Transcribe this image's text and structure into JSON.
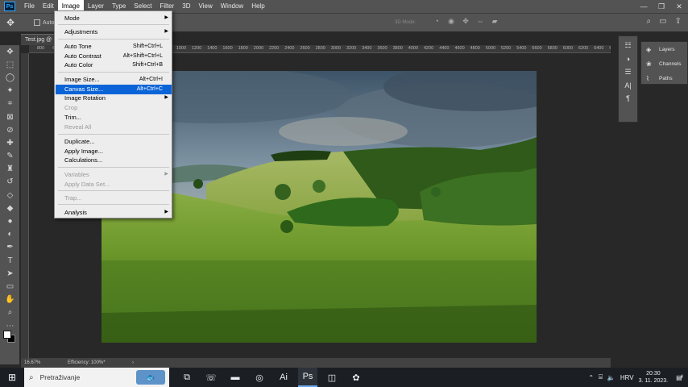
{
  "app": {
    "logo": "Ps"
  },
  "menubar": [
    "File",
    "Edit",
    "Image",
    "Layer",
    "Type",
    "Select",
    "Filter",
    "3D",
    "View",
    "Window",
    "Help"
  ],
  "window_controls": [
    "minimize-icon",
    "maximize-icon",
    "close-icon"
  ],
  "options_bar": {
    "auto_label": "Auto",
    "mode_3d": "3D Mode:"
  },
  "document": {
    "tab_title": "Test.jpg @",
    "zoom": "16.67%",
    "efficiency": "Efficiency: 100%*"
  },
  "ruler_top": [
    "800",
    "600",
    "400",
    "200",
    "0",
    "200",
    "400",
    "600",
    "800",
    "1000",
    "1200",
    "1400",
    "1600",
    "1800",
    "2000",
    "2200",
    "2400",
    "2600",
    "2800",
    "3000",
    "3200",
    "3400",
    "3600",
    "3800",
    "4000",
    "4200",
    "4400",
    "4600",
    "4800",
    "5000",
    "5200",
    "5400",
    "5600",
    "5800",
    "6000",
    "6200",
    "6400",
    "6600"
  ],
  "image_menu": [
    {
      "label": "Mode",
      "shortcut": "",
      "submenu": true,
      "disabled": false,
      "highlighted": false
    },
    {
      "label": "Adjustments",
      "shortcut": "",
      "submenu": true,
      "disabled": false,
      "highlighted": false
    },
    {
      "label": "Auto Tone",
      "shortcut": "Shift+Ctrl+L",
      "submenu": false,
      "disabled": false,
      "highlighted": false
    },
    {
      "label": "Auto Contrast",
      "shortcut": "Alt+Shift+Ctrl+L",
      "submenu": false,
      "disabled": false,
      "highlighted": false
    },
    {
      "label": "Auto Color",
      "shortcut": "Shift+Ctrl+B",
      "submenu": false,
      "disabled": false,
      "highlighted": false
    },
    {
      "label": "Image Size...",
      "shortcut": "Alt+Ctrl+I",
      "submenu": false,
      "disabled": false,
      "highlighted": false
    },
    {
      "label": "Canvas Size...",
      "shortcut": "Alt+Ctrl+C",
      "submenu": false,
      "disabled": false,
      "highlighted": true
    },
    {
      "label": "Image Rotation",
      "shortcut": "",
      "submenu": true,
      "disabled": false,
      "highlighted": false
    },
    {
      "label": "Crop",
      "shortcut": "",
      "submenu": false,
      "disabled": true,
      "highlighted": false
    },
    {
      "label": "Trim...",
      "shortcut": "",
      "submenu": false,
      "disabled": false,
      "highlighted": false
    },
    {
      "label": "Reveal All",
      "shortcut": "",
      "submenu": false,
      "disabled": true,
      "highlighted": false
    },
    {
      "label": "Duplicate...",
      "shortcut": "",
      "submenu": false,
      "disabled": false,
      "highlighted": false
    },
    {
      "label": "Apply Image...",
      "shortcut": "",
      "submenu": false,
      "disabled": false,
      "highlighted": false
    },
    {
      "label": "Calculations...",
      "shortcut": "",
      "submenu": false,
      "disabled": false,
      "highlighted": false
    },
    {
      "label": "Variables",
      "shortcut": "",
      "submenu": true,
      "disabled": true,
      "highlighted": false
    },
    {
      "label": "Apply Data Set...",
      "shortcut": "",
      "submenu": false,
      "disabled": true,
      "highlighted": false
    },
    {
      "label": "Trap...",
      "shortcut": "",
      "submenu": false,
      "disabled": true,
      "highlighted": false
    },
    {
      "label": "Analysis",
      "shortcut": "",
      "submenu": true,
      "disabled": false,
      "highlighted": false
    }
  ],
  "panels": [
    {
      "label": "Layers",
      "icon": "layers-icon"
    },
    {
      "label": "Channels",
      "icon": "channels-icon"
    },
    {
      "label": "Paths",
      "icon": "paths-icon"
    }
  ],
  "taskbar": {
    "search_placeholder": "Pretraživanje",
    "language": "HRV",
    "time": "20:30",
    "date": "3. 11. 2023.",
    "notification_count": "4"
  }
}
